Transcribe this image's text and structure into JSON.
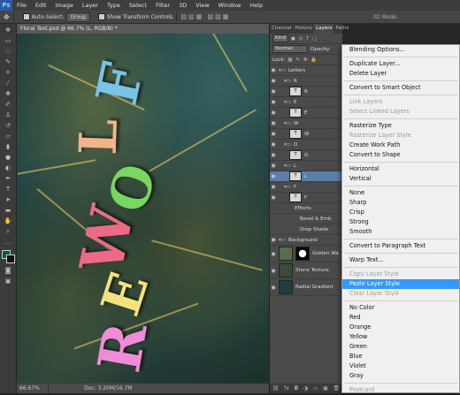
{
  "menubar": {
    "logo": "Ps",
    "items": [
      "File",
      "Edit",
      "Image",
      "Layer",
      "Type",
      "Select",
      "Filter",
      "3D",
      "View",
      "Window",
      "Help"
    ]
  },
  "options": {
    "auto_select_label": "Auto-Select:",
    "auto_select_value": "Group",
    "show_transform_label": "Show Transform Controls",
    "mode3d": "3D Mode:"
  },
  "document": {
    "tab_title": "Floral Text.psd @ 66.7% (L, RGB/8) *",
    "letters": [
      {
        "char": "F",
        "color": "#78c4e8"
      },
      {
        "char": "L",
        "color": "#f1b48a"
      },
      {
        "char": "O",
        "color": "#79d65e"
      },
      {
        "char": "W",
        "color": "#ec6a86"
      },
      {
        "char": "E",
        "color": "#f4e27e"
      },
      {
        "char": "R",
        "color": "#f08bd8"
      }
    ],
    "zoom": "66.67%",
    "doc_info": "Doc: 3.20M/16.7M"
  },
  "layers_panel": {
    "tabs": [
      "Channel",
      "History",
      "Layers",
      "Paths"
    ],
    "kind_label": "Kind",
    "blend_mode": "Normal",
    "opacity_label": "Opacity:",
    "lock_label": "Lock:",
    "layers": [
      {
        "name": "Letters",
        "type": "group"
      },
      {
        "name": "R",
        "type": "group"
      },
      {
        "name": "R",
        "type": "text"
      },
      {
        "name": "E",
        "type": "group"
      },
      {
        "name": "E",
        "type": "text"
      },
      {
        "name": "W",
        "type": "group"
      },
      {
        "name": "W",
        "type": "text"
      },
      {
        "name": "O",
        "type": "group"
      },
      {
        "name": "O",
        "type": "text"
      },
      {
        "name": "L",
        "type": "group"
      },
      {
        "name": "L",
        "type": "text",
        "selected": true
      },
      {
        "name": "F",
        "type": "group"
      },
      {
        "name": "F",
        "type": "text"
      },
      {
        "name": "Effects",
        "type": "fx"
      },
      {
        "name": "Bevel & Emb",
        "type": "fx-item"
      },
      {
        "name": "Drop Shado",
        "type": "fx-item"
      },
      {
        "name": "Background",
        "type": "group"
      },
      {
        "name": "Golden Wa",
        "type": "image"
      },
      {
        "name": "Stone Texture",
        "type": "image"
      },
      {
        "name": "Radial Gradient",
        "type": "image"
      }
    ]
  },
  "context_menu": {
    "sections": [
      [
        {
          "label": "Blending Options..."
        }
      ],
      [
        {
          "label": "Duplicate Layer..."
        },
        {
          "label": "Delete Layer"
        }
      ],
      [
        {
          "label": "Convert to Smart Object"
        }
      ],
      [
        {
          "label": "Link Layers",
          "disabled": true
        },
        {
          "label": "Select Linked Layers",
          "disabled": true
        }
      ],
      [
        {
          "label": "Rasterize Type"
        },
        {
          "label": "Rasterize Layer Style",
          "disabled": true
        },
        {
          "label": "Create Work Path"
        },
        {
          "label": "Convert to Shape"
        }
      ],
      [
        {
          "label": "Horizontal"
        },
        {
          "label": "Vertical"
        }
      ],
      [
        {
          "label": "None"
        },
        {
          "label": "Sharp"
        },
        {
          "label": "Crisp"
        },
        {
          "label": "Strong"
        },
        {
          "label": "Smooth"
        }
      ],
      [
        {
          "label": "Convert to Paragraph Text"
        }
      ],
      [
        {
          "label": "Warp Text..."
        }
      ],
      [
        {
          "label": "Copy Layer Style",
          "disabled": true
        },
        {
          "label": "Paste Layer Style",
          "highlight": true
        },
        {
          "label": "Clear Layer Style",
          "disabled": true
        }
      ],
      [
        {
          "label": "No Color"
        },
        {
          "label": "Red"
        },
        {
          "label": "Orange"
        },
        {
          "label": "Yellow"
        },
        {
          "label": "Green"
        },
        {
          "label": "Blue"
        },
        {
          "label": "Violet"
        },
        {
          "label": "Gray"
        }
      ],
      [
        {
          "label": "Postcard",
          "disabled": true
        }
      ]
    ]
  }
}
